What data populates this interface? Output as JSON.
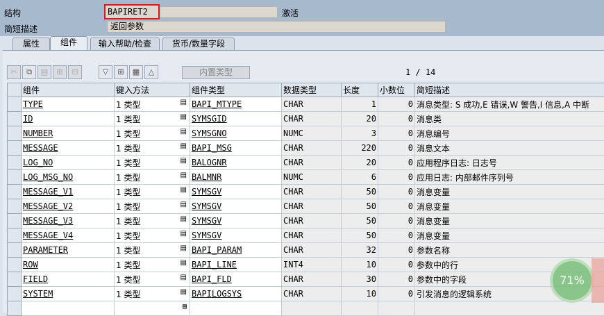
{
  "header": {
    "struct_label": "结构",
    "struct_value": "BAPIRET2",
    "status": "激活",
    "desc_label": "简短描述",
    "desc_value": "返回参数"
  },
  "tabs": [
    {
      "label": "属性"
    },
    {
      "label": "组件"
    },
    {
      "label": "输入帮助/检查"
    },
    {
      "label": "货币/数量字段"
    }
  ],
  "toolbar": {
    "builtin_type_label": "内置类型",
    "pager": "1 / 14"
  },
  "columns": [
    "组件",
    "键入方法",
    "组件类型",
    "数据类型",
    "长度",
    "小数位",
    "简短描述"
  ],
  "rows": [
    {
      "comp": "TYPE",
      "method": "1 类型",
      "ctype": "BAPI_MTYPE",
      "dtype": "CHAR",
      "len": "1",
      "dec": "0",
      "desc": "消息类型: S 成功,E 错误,W 警告,I 信息,A 中断"
    },
    {
      "comp": "ID",
      "method": "1 类型",
      "ctype": "SYMSGID",
      "dtype": "CHAR",
      "len": "20",
      "dec": "0",
      "desc": "消息类"
    },
    {
      "comp": "NUMBER",
      "method": "1 类型",
      "ctype": "SYMSGNO",
      "dtype": "NUMC",
      "len": "3",
      "dec": "0",
      "desc": "消息编号"
    },
    {
      "comp": "MESSAGE",
      "method": "1 类型",
      "ctype": "BAPI_MSG",
      "dtype": "CHAR",
      "len": "220",
      "dec": "0",
      "desc": "消息文本"
    },
    {
      "comp": "LOG_NO",
      "method": "1 类型",
      "ctype": "BALOGNR",
      "dtype": "CHAR",
      "len": "20",
      "dec": "0",
      "desc": "应用程序日志: 日志号"
    },
    {
      "comp": "LOG_MSG_NO",
      "method": "1 类型",
      "ctype": "BALMNR",
      "dtype": "NUMC",
      "len": "6",
      "dec": "0",
      "desc": "应用日志: 内部邮件序列号"
    },
    {
      "comp": "MESSAGE_V1",
      "method": "1 类型",
      "ctype": "SYMSGV",
      "dtype": "CHAR",
      "len": "50",
      "dec": "0",
      "desc": "消息变量"
    },
    {
      "comp": "MESSAGE_V2",
      "method": "1 类型",
      "ctype": "SYMSGV",
      "dtype": "CHAR",
      "len": "50",
      "dec": "0",
      "desc": "消息变量"
    },
    {
      "comp": "MESSAGE_V3",
      "method": "1 类型",
      "ctype": "SYMSGV",
      "dtype": "CHAR",
      "len": "50",
      "dec": "0",
      "desc": "消息变量"
    },
    {
      "comp": "MESSAGE_V4",
      "method": "1 类型",
      "ctype": "SYMSGV",
      "dtype": "CHAR",
      "len": "50",
      "dec": "0",
      "desc": "消息变量"
    },
    {
      "comp": "PARAMETER",
      "method": "1 类型",
      "ctype": "BAPI_PARAM",
      "dtype": "CHAR",
      "len": "32",
      "dec": "0",
      "desc": "参数名称"
    },
    {
      "comp": "ROW",
      "method": "1 类型",
      "ctype": "BAPI_LINE",
      "dtype": "INT4",
      "len": "10",
      "dec": "0",
      "desc": "参数中的行"
    },
    {
      "comp": "FIELD",
      "method": "1 类型",
      "ctype": "BAPI_FLD",
      "dtype": "CHAR",
      "len": "30",
      "dec": "0",
      "desc": "参数中的字段"
    },
    {
      "comp": "SYSTEM",
      "method": "1 类型",
      "ctype": "BAPILOGSYS",
      "dtype": "CHAR",
      "len": "10",
      "dec": "0",
      "desc": "引发消息的逻辑系统"
    }
  ],
  "overlay_badge": "71%"
}
